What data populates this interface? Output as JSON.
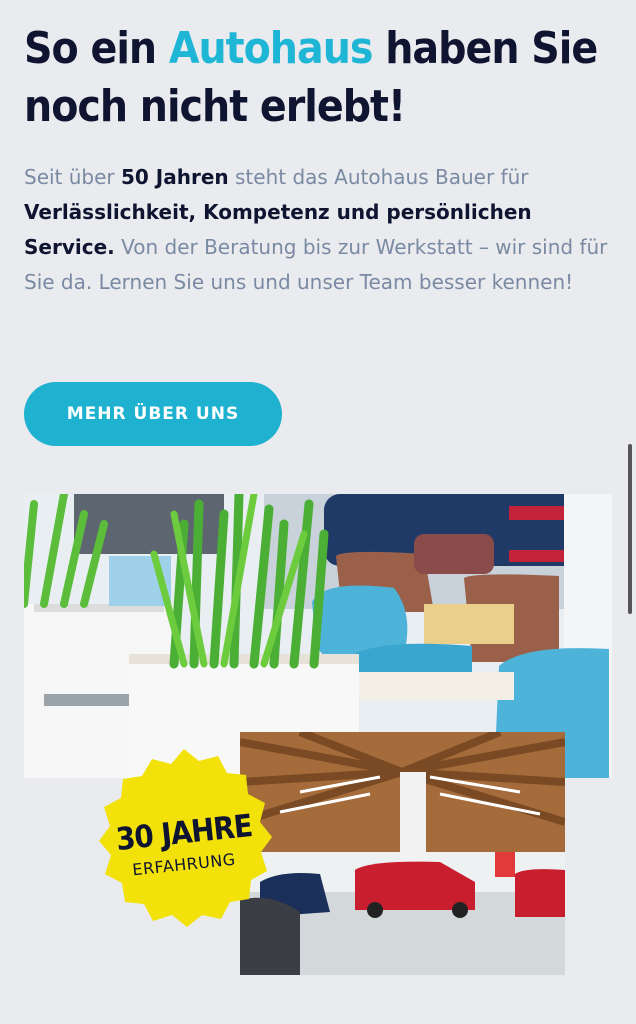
{
  "hero": {
    "title_before": "So ein ",
    "title_accent": "Autohaus",
    "title_after": " haben Sie noch nicht erlebt!",
    "intro": {
      "part1": "Seit über ",
      "bold1": "50 Jahren",
      "part2": " steht das Autohaus Bauer für ",
      "bold2": "Verlässlichkeit, Kompetenz und persönlichen Service.",
      "part3": " Von der Beratung bis zur Werkstatt – wir sind für Sie da. Lernen Sie uns und unser Team besser kennen!"
    },
    "cta_label": "MEHR ÜBER UNS"
  },
  "badge": {
    "line1": "30 JAHRE",
    "line2": "ERFAHRUNG"
  },
  "colors": {
    "accent": "#1fb6d6",
    "navy": "#0f1530",
    "badge_yellow": "#f2e20a",
    "background": "#e9ebef"
  }
}
